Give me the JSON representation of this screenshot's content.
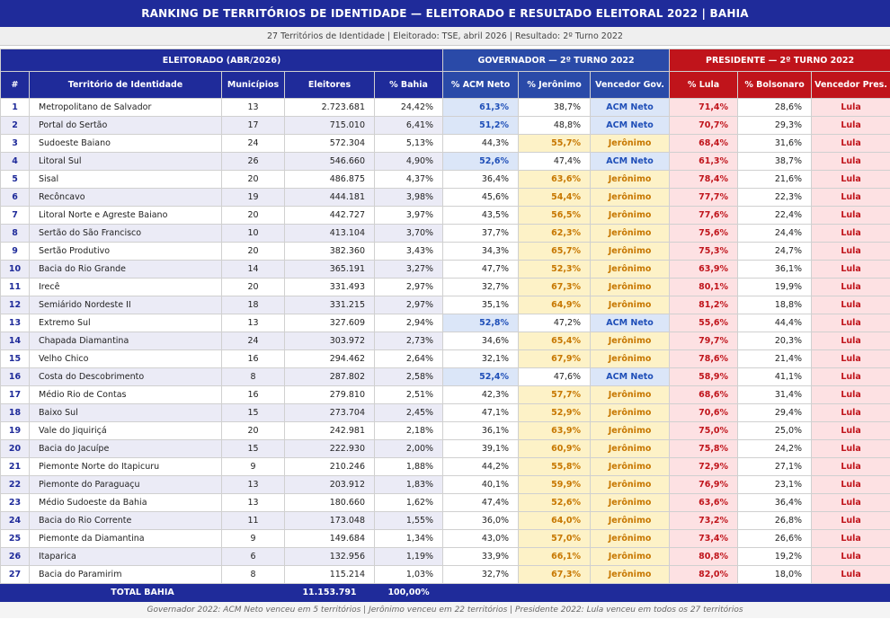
{
  "title": "RANKING DE TERRITÓRIOS DE IDENTIDADE — ELEITORADO E RESULTADO ELEITORAL 2022 | BAHIA",
  "subtitle": "27 Territórios de Identidade  |  Eleitorado: TSE, abril 2026  |  Resultado: 2º Turno 2022",
  "groups": {
    "eleitorado": "ELEITORADO (ABR/2026)",
    "governador": "GOVERNADOR — 2º TURNO 2022",
    "presidente": "PRESIDENTE — 2º TURNO 2022"
  },
  "headers": [
    "#",
    "Território de Identidade",
    "Municípios",
    "Eleitores",
    "% Bahia",
    "% ACM Neto",
    "% Jerônimo",
    "Vencedor Gov.",
    "% Lula",
    "% Bolsonaro",
    "Vencedor Pres."
  ],
  "rows": [
    {
      "n": "1",
      "t": "Metropolitano de Salvador",
      "m": "13",
      "e": "2.723.681",
      "b": "24,42%",
      "acm": "61,3%",
      "jer": "38,7%",
      "vg": "ACM Neto",
      "lula": "71,4%",
      "bol": "28,6%",
      "vp": "Lula"
    },
    {
      "n": "2",
      "t": "Portal do Sertão",
      "m": "17",
      "e": "715.010",
      "b": "6,41%",
      "acm": "51,2%",
      "jer": "48,8%",
      "vg": "ACM Neto",
      "lula": "70,7%",
      "bol": "29,3%",
      "vp": "Lula"
    },
    {
      "n": "3",
      "t": "Sudoeste Baiano",
      "m": "24",
      "e": "572.304",
      "b": "5,13%",
      "acm": "44,3%",
      "jer": "55,7%",
      "vg": "Jerônimo",
      "lula": "68,4%",
      "bol": "31,6%",
      "vp": "Lula"
    },
    {
      "n": "4",
      "t": "Litoral Sul",
      "m": "26",
      "e": "546.660",
      "b": "4,90%",
      "acm": "52,6%",
      "jer": "47,4%",
      "vg": "ACM Neto",
      "lula": "61,3%",
      "bol": "38,7%",
      "vp": "Lula"
    },
    {
      "n": "5",
      "t": "Sisal",
      "m": "20",
      "e": "486.875",
      "b": "4,37%",
      "acm": "36,4%",
      "jer": "63,6%",
      "vg": "Jerônimo",
      "lula": "78,4%",
      "bol": "21,6%",
      "vp": "Lula"
    },
    {
      "n": "6",
      "t": "Recôncavo",
      "m": "19",
      "e": "444.181",
      "b": "3,98%",
      "acm": "45,6%",
      "jer": "54,4%",
      "vg": "Jerônimo",
      "lula": "77,7%",
      "bol": "22,3%",
      "vp": "Lula"
    },
    {
      "n": "7",
      "t": "Litoral Norte e Agreste Baiano",
      "m": "20",
      "e": "442.727",
      "b": "3,97%",
      "acm": "43,5%",
      "jer": "56,5%",
      "vg": "Jerônimo",
      "lula": "77,6%",
      "bol": "22,4%",
      "vp": "Lula"
    },
    {
      "n": "8",
      "t": "Sertão do São Francisco",
      "m": "10",
      "e": "413.104",
      "b": "3,70%",
      "acm": "37,7%",
      "jer": "62,3%",
      "vg": "Jerônimo",
      "lula": "75,6%",
      "bol": "24,4%",
      "vp": "Lula"
    },
    {
      "n": "9",
      "t": "Sertão Produtivo",
      "m": "20",
      "e": "382.360",
      "b": "3,43%",
      "acm": "34,3%",
      "jer": "65,7%",
      "vg": "Jerônimo",
      "lula": "75,3%",
      "bol": "24,7%",
      "vp": "Lula"
    },
    {
      "n": "10",
      "t": "Bacia do Rio Grande",
      "m": "14",
      "e": "365.191",
      "b": "3,27%",
      "acm": "47,7%",
      "jer": "52,3%",
      "vg": "Jerônimo",
      "lula": "63,9%",
      "bol": "36,1%",
      "vp": "Lula"
    },
    {
      "n": "11",
      "t": "Irecê",
      "m": "20",
      "e": "331.493",
      "b": "2,97%",
      "acm": "32,7%",
      "jer": "67,3%",
      "vg": "Jerônimo",
      "lula": "80,1%",
      "bol": "19,9%",
      "vp": "Lula"
    },
    {
      "n": "12",
      "t": "Semiárido Nordeste II",
      "m": "18",
      "e": "331.215",
      "b": "2,97%",
      "acm": "35,1%",
      "jer": "64,9%",
      "vg": "Jerônimo",
      "lula": "81,2%",
      "bol": "18,8%",
      "vp": "Lula"
    },
    {
      "n": "13",
      "t": "Extremo Sul",
      "m": "13",
      "e": "327.609",
      "b": "2,94%",
      "acm": "52,8%",
      "jer": "47,2%",
      "vg": "ACM Neto",
      "lula": "55,6%",
      "bol": "44,4%",
      "vp": "Lula"
    },
    {
      "n": "14",
      "t": "Chapada Diamantina",
      "m": "24",
      "e": "303.972",
      "b": "2,73%",
      "acm": "34,6%",
      "jer": "65,4%",
      "vg": "Jerônimo",
      "lula": "79,7%",
      "bol": "20,3%",
      "vp": "Lula"
    },
    {
      "n": "15",
      "t": "Velho Chico",
      "m": "16",
      "e": "294.462",
      "b": "2,64%",
      "acm": "32,1%",
      "jer": "67,9%",
      "vg": "Jerônimo",
      "lula": "78,6%",
      "bol": "21,4%",
      "vp": "Lula"
    },
    {
      "n": "16",
      "t": "Costa do Descobrimento",
      "m": "8",
      "e": "287.802",
      "b": "2,58%",
      "acm": "52,4%",
      "jer": "47,6%",
      "vg": "ACM Neto",
      "lula": "58,9%",
      "bol": "41,1%",
      "vp": "Lula"
    },
    {
      "n": "17",
      "t": "Médio Rio de Contas",
      "m": "16",
      "e": "279.810",
      "b": "2,51%",
      "acm": "42,3%",
      "jer": "57,7%",
      "vg": "Jerônimo",
      "lula": "68,6%",
      "bol": "31,4%",
      "vp": "Lula"
    },
    {
      "n": "18",
      "t": "Baixo Sul",
      "m": "15",
      "e": "273.704",
      "b": "2,45%",
      "acm": "47,1%",
      "jer": "52,9%",
      "vg": "Jerônimo",
      "lula": "70,6%",
      "bol": "29,4%",
      "vp": "Lula"
    },
    {
      "n": "19",
      "t": "Vale do Jiquiriçá",
      "m": "20",
      "e": "242.981",
      "b": "2,18%",
      "acm": "36,1%",
      "jer": "63,9%",
      "vg": "Jerônimo",
      "lula": "75,0%",
      "bol": "25,0%",
      "vp": "Lula"
    },
    {
      "n": "20",
      "t": "Bacia do Jacuípe",
      "m": "15",
      "e": "222.930",
      "b": "2,00%",
      "acm": "39,1%",
      "jer": "60,9%",
      "vg": "Jerônimo",
      "lula": "75,8%",
      "bol": "24,2%",
      "vp": "Lula"
    },
    {
      "n": "21",
      "t": "Piemonte Norte do Itapicuru",
      "m": "9",
      "e": "210.246",
      "b": "1,88%",
      "acm": "44,2%",
      "jer": "55,8%",
      "vg": "Jerônimo",
      "lula": "72,9%",
      "bol": "27,1%",
      "vp": "Lula"
    },
    {
      "n": "22",
      "t": "Piemonte do Paraguaçu",
      "m": "13",
      "e": "203.912",
      "b": "1,83%",
      "acm": "40,1%",
      "jer": "59,9%",
      "vg": "Jerônimo",
      "lula": "76,9%",
      "bol": "23,1%",
      "vp": "Lula"
    },
    {
      "n": "23",
      "t": "Médio Sudoeste da Bahia",
      "m": "13",
      "e": "180.660",
      "b": "1,62%",
      "acm": "47,4%",
      "jer": "52,6%",
      "vg": "Jerônimo",
      "lula": "63,6%",
      "bol": "36,4%",
      "vp": "Lula"
    },
    {
      "n": "24",
      "t": "Bacia do Rio Corrente",
      "m": "11",
      "e": "173.048",
      "b": "1,55%",
      "acm": "36,0%",
      "jer": "64,0%",
      "vg": "Jerônimo",
      "lula": "73,2%",
      "bol": "26,8%",
      "vp": "Lula"
    },
    {
      "n": "25",
      "t": "Piemonte da Diamantina",
      "m": "9",
      "e": "149.684",
      "b": "1,34%",
      "acm": "43,0%",
      "jer": "57,0%",
      "vg": "Jerônimo",
      "lula": "73,4%",
      "bol": "26,6%",
      "vp": "Lula"
    },
    {
      "n": "26",
      "t": "Itaparica",
      "m": "6",
      "e": "132.956",
      "b": "1,19%",
      "acm": "33,9%",
      "jer": "66,1%",
      "vg": "Jerônimo",
      "lula": "80,8%",
      "bol": "19,2%",
      "vp": "Lula"
    },
    {
      "n": "27",
      "t": "Bacia do Paramirim",
      "m": "8",
      "e": "115.214",
      "b": "1,03%",
      "acm": "32,7%",
      "jer": "67,3%",
      "vg": "Jerônimo",
      "lula": "82,0%",
      "bol": "18,0%",
      "vp": "Lula"
    }
  ],
  "total": {
    "label": "TOTAL BAHIA",
    "eleitores": "11.153.791",
    "pct": "100,00%"
  },
  "footer": "Governador 2022: ACM Neto venceu em 5 territórios  |  Jerônimo venceu em 22 territórios  |  Presidente 2022: Lula venceu em todos os 27 territórios",
  "colors": {
    "header_blue": "#1f2b9a",
    "header_red": "#c0141b",
    "acm": "#1f4fb8",
    "jeronimo": "#c77700",
    "lula": "#c0141b"
  }
}
